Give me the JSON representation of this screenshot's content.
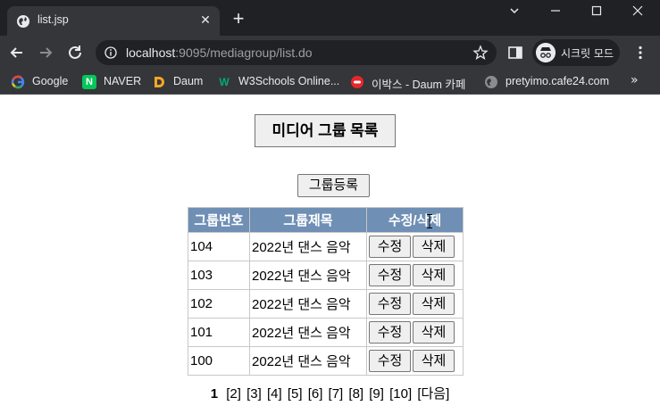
{
  "browser": {
    "tab_title": "list.jsp",
    "url_host": "localhost",
    "url_rest": ":9095/mediagroup/list.do",
    "profile_label": "시크릿 모드",
    "bookmarks": [
      {
        "label": "Google",
        "icon": "google-icon"
      },
      {
        "label": "NAVER",
        "icon": "naver-icon"
      },
      {
        "label": "Daum",
        "icon": "daum-icon"
      },
      {
        "label": "W3Schools Online...",
        "icon": "w3schools-icon"
      },
      {
        "label": "이박스 - Daum 카페",
        "icon": "daum-cafe-icon"
      },
      {
        "label": "pretyimo.cafe24.com",
        "icon": "globe-icon"
      }
    ],
    "bookmarks_more": "»"
  },
  "page": {
    "title": "미디어 그룹 목록",
    "register_button": "그룹등록",
    "table": {
      "headers": [
        "그룹번호",
        "그룹제목",
        "수정/삭제"
      ],
      "rows": [
        {
          "no": "104",
          "title": "2022년 댄스 음악",
          "edit": "수정",
          "delete": "삭제"
        },
        {
          "no": "103",
          "title": "2022년 댄스 음악",
          "edit": "수정",
          "delete": "삭제"
        },
        {
          "no": "102",
          "title": "2022년 댄스 음악",
          "edit": "수정",
          "delete": "삭제"
        },
        {
          "no": "101",
          "title": "2022년 댄스 음악",
          "edit": "수정",
          "delete": "삭제"
        },
        {
          "no": "100",
          "title": "2022년 댄스 음악",
          "edit": "수정",
          "delete": "삭제"
        }
      ]
    },
    "pagination": {
      "current": "1",
      "pages": [
        "[2]",
        "[3]",
        "[4]",
        "[5]",
        "[6]",
        "[7]",
        "[8]",
        "[9]",
        "[10]"
      ],
      "next": "[다음]"
    }
  },
  "colors": {
    "header_bg": "#6f8fb5",
    "chrome_dark": "#202124",
    "chrome_mid": "#35363a"
  }
}
